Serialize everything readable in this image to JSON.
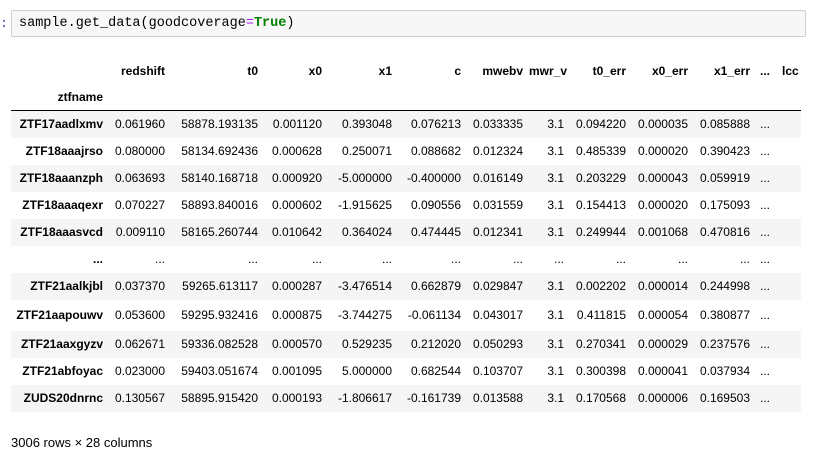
{
  "cell": {
    "prompt": ":",
    "code_prefix": "sample.get_data(",
    "code_kwarg": "goodcoverage",
    "code_eq": "=",
    "code_value": "True",
    "code_suffix": ")"
  },
  "table": {
    "index_name": "ztfname",
    "columns": [
      "redshift",
      "t0",
      "x0",
      "x1",
      "c",
      "mwebv",
      "mwr_v",
      "t0_err",
      "x0_err",
      "x1_err",
      "...",
      "lcc"
    ],
    "rows": [
      {
        "index": "ZTF17aadlxmv",
        "values": [
          "0.061960",
          "58878.193135",
          "0.001120",
          "0.393048",
          "0.076213",
          "0.033335",
          "3.1",
          "0.094220",
          "0.000035",
          "0.085888",
          "..."
        ]
      },
      {
        "index": "ZTF18aaajrso",
        "values": [
          "0.080000",
          "58134.692436",
          "0.000628",
          "0.250071",
          "0.088682",
          "0.012324",
          "3.1",
          "0.485339",
          "0.000020",
          "0.390423",
          "..."
        ]
      },
      {
        "index": "ZTF18aaanzph",
        "values": [
          "0.063693",
          "58140.168718",
          "0.000920",
          "-5.000000",
          "-0.400000",
          "0.016149",
          "3.1",
          "0.203229",
          "0.000043",
          "0.059919",
          "..."
        ]
      },
      {
        "index": "ZTF18aaaqexr",
        "values": [
          "0.070227",
          "58893.840016",
          "0.000602",
          "-1.915625",
          "0.090556",
          "0.031559",
          "3.1",
          "0.154413",
          "0.000020",
          "0.175093",
          "..."
        ]
      },
      {
        "index": "ZTF18aaasvcd",
        "values": [
          "0.009110",
          "58165.260744",
          "0.010642",
          "0.364024",
          "0.474445",
          "0.012341",
          "3.1",
          "0.249944",
          "0.001068",
          "0.470816",
          "..."
        ]
      },
      {
        "index": "...",
        "values": [
          "...",
          "...",
          "...",
          "...",
          "...",
          "...",
          "...",
          "...",
          "...",
          "...",
          "..."
        ]
      },
      {
        "index": "ZTF21aalkjbl",
        "values": [
          "0.037370",
          "59265.613117",
          "0.000287",
          "-3.476514",
          "0.662879",
          "0.029847",
          "3.1",
          "0.002202",
          "0.000014",
          "0.244998",
          "..."
        ]
      },
      {
        "index": "ZTF21aapouwv",
        "values": [
          "0.053600",
          "59295.932416",
          "0.000875",
          "-3.744275",
          "-0.061134",
          "0.043017",
          "3.1",
          "0.411815",
          "0.000054",
          "0.380877",
          "..."
        ]
      },
      {
        "index": "ZTF21aaxgyzv",
        "values": [
          "0.062671",
          "59336.082528",
          "0.000570",
          "0.529235",
          "0.212020",
          "0.050293",
          "3.1",
          "0.270341",
          "0.000029",
          "0.237576",
          "..."
        ]
      },
      {
        "index": "ZTF21abfoyac",
        "values": [
          "0.023000",
          "59403.051674",
          "0.001095",
          "5.000000",
          "0.682544",
          "0.103707",
          "3.1",
          "0.300398",
          "0.000041",
          "0.037934",
          "..."
        ]
      },
      {
        "index": "ZUDS20dnrnc",
        "values": [
          "0.130567",
          "58895.915420",
          "0.000193",
          "-1.806617",
          "-0.161739",
          "0.013588",
          "3.1",
          "0.170568",
          "0.000006",
          "0.169503",
          "..."
        ]
      }
    ]
  },
  "footer": "3006 rows × 28 columns"
}
